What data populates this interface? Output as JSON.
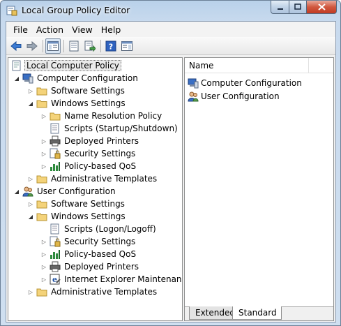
{
  "window": {
    "title": "Local Group Policy Editor"
  },
  "menu": [
    "File",
    "Action",
    "View",
    "Help"
  ],
  "toolbar": {
    "buttons": [
      "back-icon",
      "forward-icon",
      "show-hide-tree-icon",
      "properties-icon",
      "export-list-icon",
      "help-icon",
      "show-hide-action-pane-icon"
    ]
  },
  "tree": {
    "root": "Local Computer Policy",
    "computer_config": {
      "label": "Computer Configuration",
      "software_settings": "Software Settings",
      "windows_settings": "Windows Settings",
      "name_resolution_policy": "Name Resolution Policy",
      "scripts": "Scripts (Startup/Shutdown)",
      "deployed_printers": "Deployed Printers",
      "security_settings": "Security Settings",
      "policy_based_qos": "Policy-based QoS",
      "admin_templates": "Administrative Templates"
    },
    "user_config": {
      "label": "User Configuration",
      "software_settings": "Software Settings",
      "windows_settings": "Windows Settings",
      "scripts": "Scripts (Logon/Logoff)",
      "security_settings": "Security Settings",
      "policy_based_qos": "Policy-based QoS",
      "deployed_printers": "Deployed Printers",
      "ie_maintenance": "Internet Explorer Maintenance",
      "admin_templates": "Administrative Templates"
    }
  },
  "list": {
    "column_name": "Name",
    "items": [
      "Computer Configuration",
      "User Configuration"
    ]
  },
  "tabs": [
    "Extended",
    "Standard"
  ],
  "selected_tab": "Standard"
}
